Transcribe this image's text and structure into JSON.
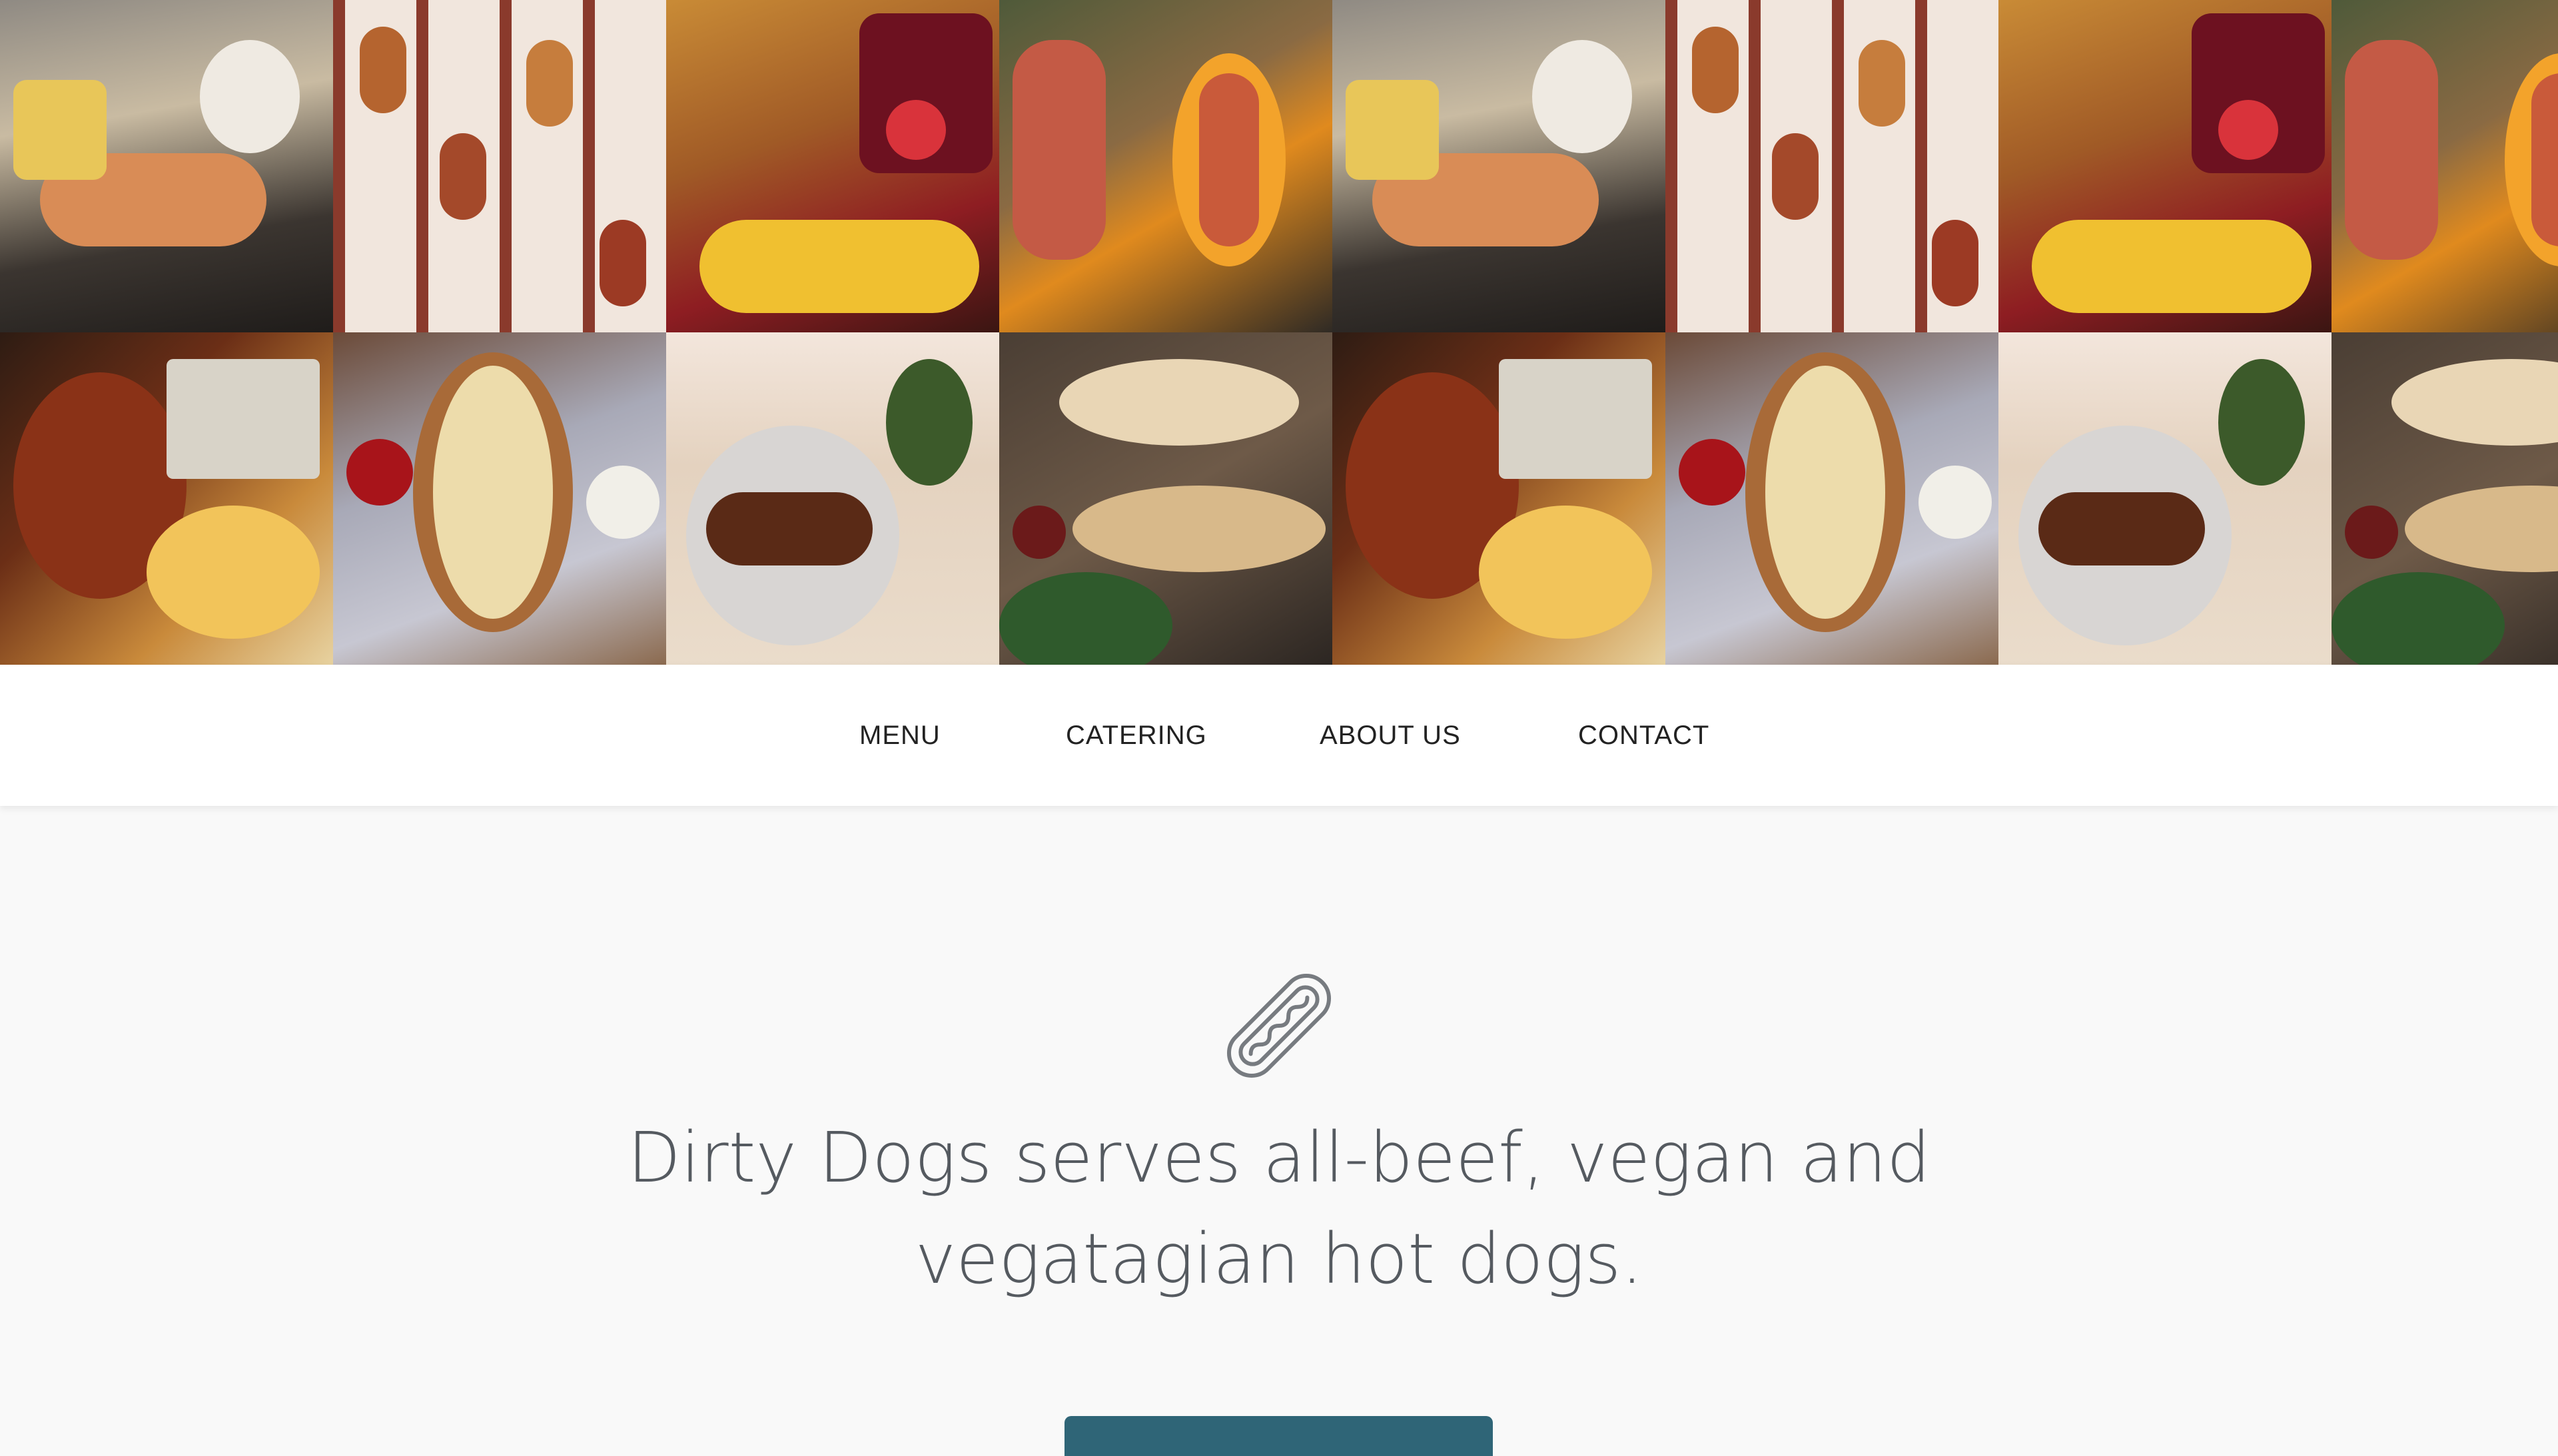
{
  "nav": {
    "items": [
      {
        "label": "MENU"
      },
      {
        "label": "CATERING"
      },
      {
        "label": "ABOUT US"
      },
      {
        "label": "CONTACT"
      }
    ]
  },
  "hero": {
    "icon": "hotdog-icon",
    "tagline": "Dirty Dogs serves all-beef, vegan and vegatagian hot dogs."
  },
  "colors": {
    "accent": "#2f6577",
    "text": "#555a60",
    "nav_text": "#222222",
    "page_bg": "#f9f9f9"
  }
}
